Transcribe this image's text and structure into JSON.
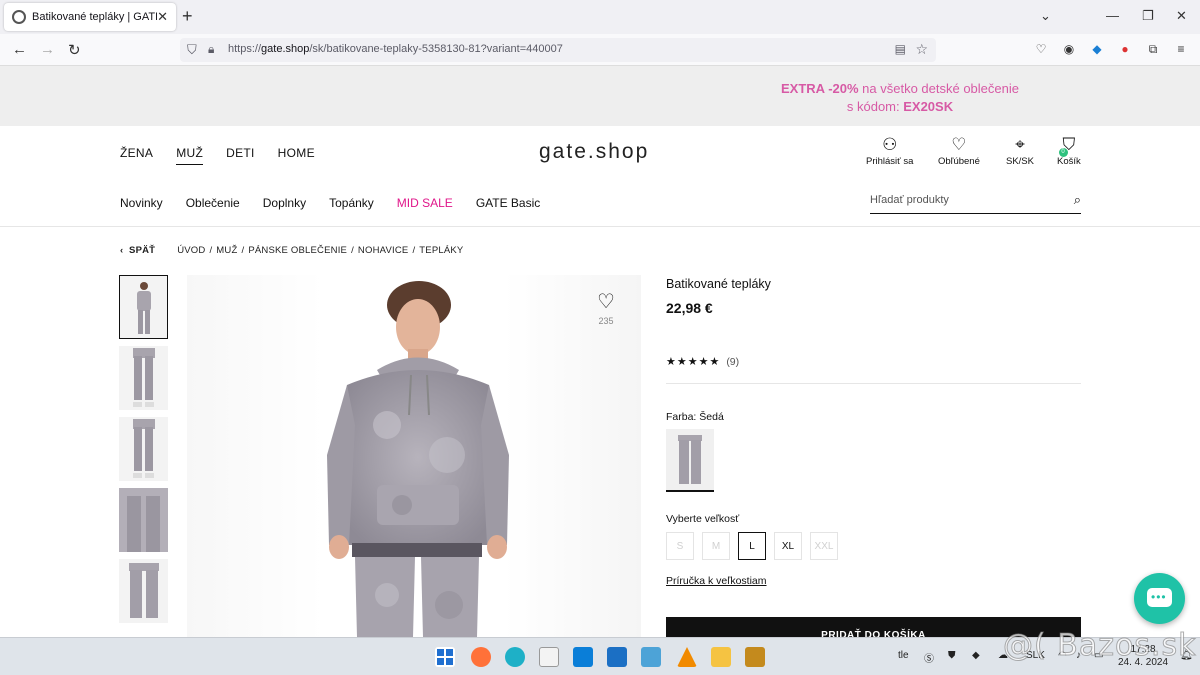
{
  "browser": {
    "tab_title": "Batikované tepláky | GATE",
    "url_prefix": "https://",
    "url_domain": "gate.shop",
    "url_path": "/sk/batikovane-teplaky-5358130-81?variant=440007"
  },
  "promo": {
    "line1_highlight": "EXTRA -20%",
    "line1_rest": " na všetko detské oblečenie",
    "line2_prefix": "s kódom: ",
    "code": "EX20SK",
    "color": "#d75aa5"
  },
  "header": {
    "gender_nav": [
      "ŽENA",
      "MUŽ",
      "DETI",
      "HOME"
    ],
    "active_gender": "MUŽ",
    "logo": "gate.shop",
    "actions": {
      "login": "Prihlásiť sa",
      "favorites": "Obľúbené",
      "region": "SK/SK",
      "cart": "Košík",
      "cart_count": "0"
    },
    "categories": [
      "Novinky",
      "Oblečenie",
      "Doplnky",
      "Topánky",
      "MID SALE",
      "GATE Basic"
    ],
    "sale_color": "#e0168a",
    "search_placeholder": "Hľadať produkty"
  },
  "breadcrumb": {
    "back": "SPÄŤ",
    "items": [
      "ÚVOD",
      "MUŽ",
      "PÁNSKE OBLEČENIE",
      "NOHAVICE",
      "TEPLÁKY"
    ]
  },
  "product": {
    "name": "Batikované tepláky",
    "price": "22,98 €",
    "rating_stars": "★★★★★",
    "rating_count": "(9)",
    "wishlist_count": "235",
    "color_label": "Farba: Šedá",
    "size_label": "Vyberte veľkosť",
    "sizes": [
      {
        "label": "S",
        "state": "unavailable"
      },
      {
        "label": "M",
        "state": "unavailable"
      },
      {
        "label": "L",
        "state": "selected"
      },
      {
        "label": "XL",
        "state": "available"
      },
      {
        "label": "XXL",
        "state": "unavailable"
      }
    ],
    "size_guide": "Príručka k veľkostiam",
    "add_to_cart": "PRIDAŤ DO KOŠÍKA"
  },
  "taskbar": {
    "tray_label": "SLK",
    "time": "17:28",
    "date": "24. 4. 2024"
  },
  "watermark": "@( Bazos.sk"
}
